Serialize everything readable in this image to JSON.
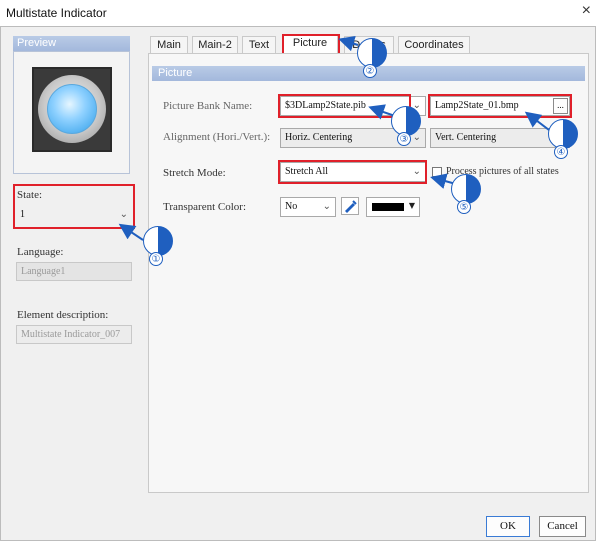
{
  "window": {
    "title": "Multistate Indicator",
    "close": "×"
  },
  "left": {
    "preview_header": "Preview",
    "state_label": "State:",
    "state_value": "1",
    "language_label": "Language:",
    "language_value": "Language1",
    "element_desc_label": "Element description:",
    "element_desc_value": "Multistate Indicator_007"
  },
  "tabs": [
    "Main",
    "Main-2",
    "Text",
    "Picture",
    "Details",
    "Coordinates"
  ],
  "picture": {
    "header": "Picture",
    "bank_label": "Picture Bank Name:",
    "bank_value": "$3DLamp2State.pib",
    "file_value": "Lamp2State_01.bmp",
    "browse": "...",
    "align_label": "Alignment (Hori./Vert.):",
    "align_h": "Horiz. Centering",
    "align_v": "Vert. Centering",
    "stretch_label": "Stretch Mode:",
    "stretch_value": "Stretch All",
    "process_all": "Process pictures of all states",
    "transparent_label": "Transparent Color:",
    "transparent_value": "No"
  },
  "callouts": [
    "①",
    "②",
    "③",
    "④",
    "⑤"
  ],
  "buttons": {
    "ok": "OK",
    "cancel": "Cancel"
  },
  "colors": {
    "accent": "#1f5fbf",
    "highlight": "#e0202a",
    "header": "#a3b8dc"
  }
}
